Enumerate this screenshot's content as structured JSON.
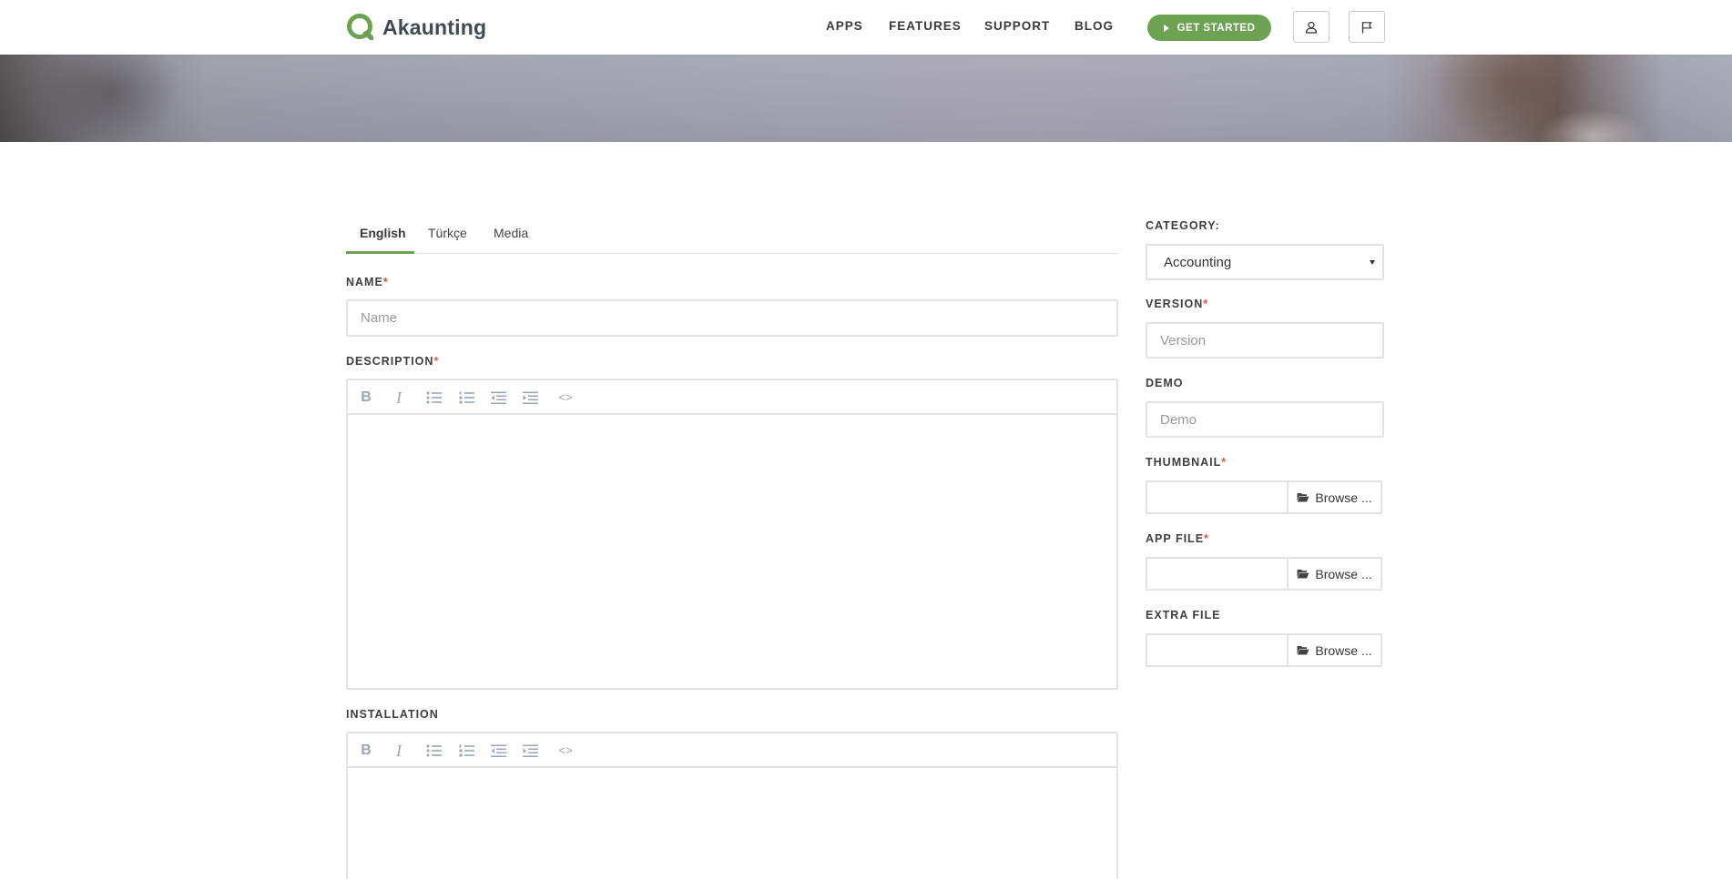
{
  "brand": {
    "name": "Akaunting",
    "accent": "#6da252"
  },
  "nav": {
    "links": [
      "APPS",
      "FEATURES",
      "SUPPORT",
      "BLOG"
    ],
    "cta_label": "GET STARTED",
    "user_icon": "user-icon",
    "flag_icon": "flag-icon"
  },
  "tabs": [
    {
      "label": "English",
      "active": true
    },
    {
      "label": "Türkçe",
      "active": false
    },
    {
      "label": "Media",
      "active": false
    }
  ],
  "form": {
    "name": {
      "label": "NAME",
      "required": "*",
      "placeholder": "Name"
    },
    "description": {
      "label": "DESCRIPTION",
      "required": "*"
    },
    "installation": {
      "label": "INSTALLATION"
    },
    "category": {
      "label": "CATEGORY:",
      "value": "Accounting"
    },
    "version": {
      "label": "VERSION",
      "required": "*",
      "placeholder": "Version"
    },
    "demo": {
      "label": "DEMO",
      "placeholder": "Demo"
    },
    "thumbnail": {
      "label": "THUMBNAIL",
      "required": "*",
      "browse": "Browse ..."
    },
    "app_file": {
      "label": "APP FILE",
      "required": "*",
      "browse": "Browse ..."
    },
    "extra_file": {
      "label": "EXTRA FILE",
      "browse": "Browse ..."
    }
  },
  "editor_toolbar": {
    "bold": "B",
    "italic": "I",
    "code": "<>",
    "icons": [
      "bold-icon",
      "italic-icon",
      "bullet-list-icon",
      "numbered-list-icon",
      "outdent-icon",
      "indent-icon",
      "code-view-icon"
    ]
  }
}
